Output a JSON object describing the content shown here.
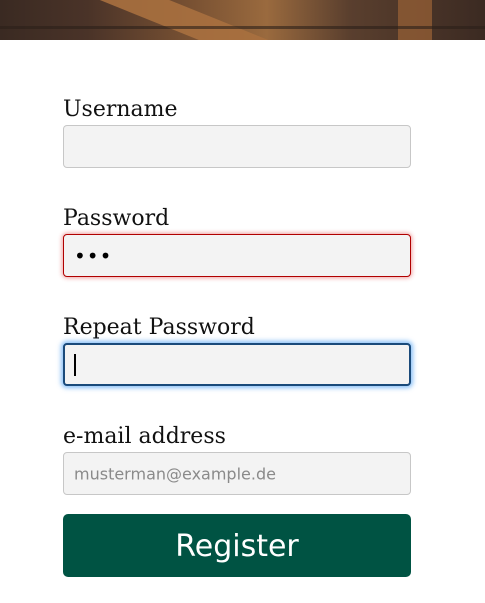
{
  "form": {
    "username": {
      "label": "Username",
      "value": ""
    },
    "password": {
      "label": "Password",
      "value": "•••"
    },
    "repeat_password": {
      "label": "Repeat Password",
      "value": ""
    },
    "email": {
      "label": "e-mail address",
      "placeholder": "musterman@example.de"
    },
    "register_label": "Register"
  },
  "colors": {
    "button_bg": "#005343",
    "error_border": "#b00000",
    "focus_ring": "#288cf0"
  }
}
